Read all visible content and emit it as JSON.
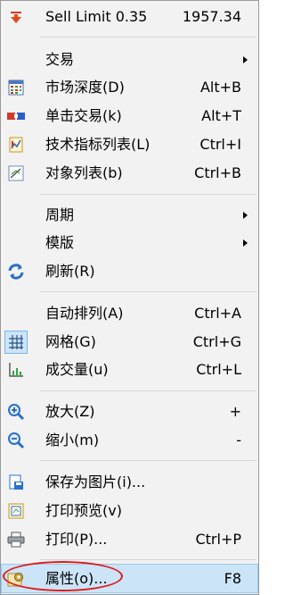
{
  "menu": {
    "sell_limit": {
      "label": "Sell Limit 0.35",
      "shortcut": "1957.34",
      "icon": "red-down-arrow-icon"
    },
    "trade": {
      "label": "交易",
      "icon": "none"
    },
    "market_depth": {
      "label": "市场深度(D)",
      "shortcut": "Alt+B",
      "icon": "market-depth-icon"
    },
    "one_click": {
      "label": "单击交易(k)",
      "shortcut": "Alt+T",
      "icon": "one-click-trading-icon"
    },
    "indicators": {
      "label": "技术指标列表(L)",
      "shortcut": "Ctrl+I",
      "icon": "indicators-list-icon"
    },
    "objects": {
      "label": "对象列表(b)",
      "shortcut": "Ctrl+B",
      "icon": "objects-list-icon"
    },
    "period": {
      "label": "周期",
      "icon": "none"
    },
    "template": {
      "label": "模版",
      "icon": "none"
    },
    "refresh": {
      "label": "刷新(R)",
      "icon": "refresh-icon"
    },
    "autoscroll": {
      "label": "自动排列(A)",
      "shortcut": "Ctrl+A",
      "icon": "none"
    },
    "grid": {
      "label": "网格(G)",
      "shortcut": "Ctrl+G",
      "icon": "grid-icon",
      "checked": true
    },
    "volumes": {
      "label": "成交量(u)",
      "shortcut": "Ctrl+L",
      "icon": "volumes-icon"
    },
    "zoom_in": {
      "label": "放大(Z)",
      "shortcut": "+",
      "icon": "zoom-in-icon"
    },
    "zoom_out": {
      "label": "缩小(m)",
      "shortcut": "-",
      "icon": "zoom-out-icon"
    },
    "save_picture": {
      "label": "保存为图片(i)...",
      "icon": "save-picture-icon"
    },
    "print_preview": {
      "label": "打印预览(v)",
      "icon": "print-preview-icon"
    },
    "print": {
      "label": "打印(P)...",
      "shortcut": "Ctrl+P",
      "icon": "printer-icon"
    },
    "properties": {
      "label": "属性(o)...",
      "shortcut": "F8",
      "icon": "properties-gear-icon",
      "highlighted": true
    }
  },
  "colors": {
    "highlight": "#cce4f7",
    "annotation_circle": "#e01a1a",
    "menu_bg": "#f2f2f2"
  }
}
